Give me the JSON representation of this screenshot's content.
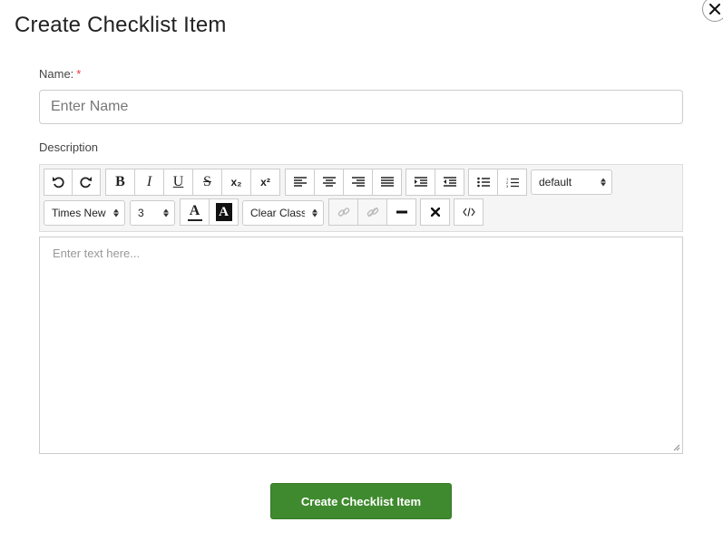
{
  "dialog": {
    "title": "Create Checklist Item",
    "name_label": "Name:",
    "required_mark": "*",
    "name_placeholder": "Enter Name",
    "description_label": "Description",
    "submit_label": "Create Checklist Item"
  },
  "toolbar": {
    "bold": "B",
    "italic": "I",
    "underline": "U",
    "strike": "S",
    "subscript": "x₂",
    "superscript": "x²",
    "paragraph_select": "default",
    "font_family_select": "Times New Roman",
    "font_size_select": "3",
    "font_color": "A",
    "background_color": "A",
    "class_select": "Clear Class"
  },
  "editor": {
    "placeholder": "Enter text here..."
  },
  "colors": {
    "submit_bg": "#3f8a2e",
    "required": "#e53935",
    "toolbar_bg": "#f5f5f5"
  }
}
